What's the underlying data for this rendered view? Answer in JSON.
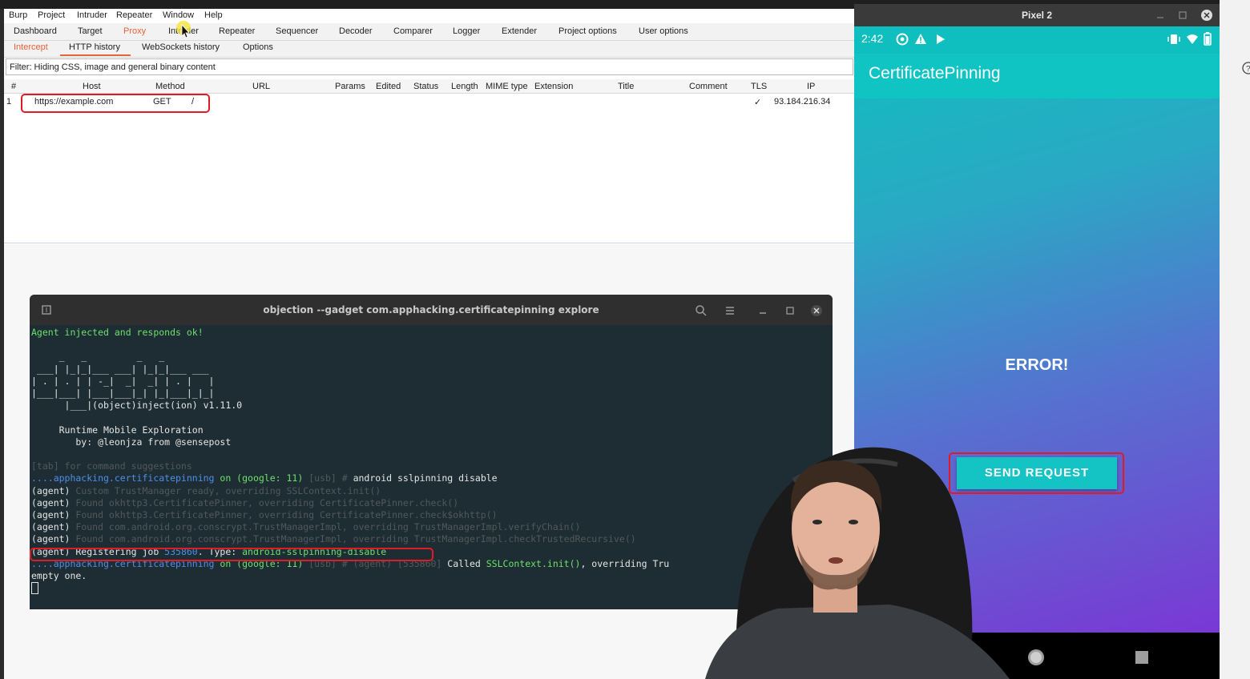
{
  "burp": {
    "menu": [
      "Burp",
      "Project",
      "Intruder",
      "Repeater",
      "Window",
      "Help"
    ],
    "tabs": [
      "Dashboard",
      "Target",
      "Proxy",
      "Intruder",
      "Repeater",
      "Sequencer",
      "Decoder",
      "Comparer",
      "Logger",
      "Extender",
      "Project options",
      "User options"
    ],
    "subtabs": [
      "Intercept",
      "HTTP history",
      "WebSockets history",
      "Options"
    ],
    "filter": "Filter: Hiding CSS, image and general binary content",
    "columns": [
      "#",
      "Host",
      "Method",
      "URL",
      "Params",
      "Edited",
      "Status",
      "Length",
      "MIME type",
      "Extension",
      "Title",
      "Comment",
      "TLS",
      "IP"
    ],
    "row": {
      "num": "1",
      "host": "https://example.com",
      "method": "GET",
      "url": "/",
      "tls": "✓",
      "ip": "93.184.216.34"
    }
  },
  "terminal": {
    "title": "objection --gadget com.apphacking.certificatepinning explore",
    "lines": {
      "injected": "Agent injected and responds ok!",
      "art1": "     _   _         _   _",
      "art2": " ___| |_|_|___ ___| |_|_|___ ___",
      "art3": "| . | . | | -_|  _|  _| | . |   |",
      "art4": "|___|___| |___|___|_| |_|___|_|_|",
      "art5": "      |___|(object)inject(ion) v1.11.0",
      "rt1": "     Runtime Mobile Exploration",
      "rt2": "        by: @leonjza from @sensepost",
      "tab": "[tab] for command suggestions",
      "p1a": "....apphacking.certificatepinning",
      "p1b": " on (google: 11) ",
      "p1c": "[usb] # ",
      "p1d": "android sslpinning disable",
      "ag": "(agent) ",
      "a1": "Custom TrustManager ready, overriding SSLContext.init()",
      "a2": "Found okhttp3.CertificatePinner, overriding CertificatePinner.check()",
      "a3": "Found okhttp3.CertificatePinner, overriding CertificatePinner.check$okhttp()",
      "a4": "Found com.android.org.conscrypt.TrustManagerImpl, overriding TrustManagerImpl.verifyChain()",
      "a5": "Found com.android.org.conscrypt.TrustManagerImpl, overriding TrustManagerImpl.checkTrustedRecursive()",
      "reg1": "(agent) Registering job ",
      "regjob": "535860",
      "reg2": ". Type: ",
      "regtype": "android-sslpinning-disable",
      "p2c": "[usb] # (agent) ",
      "p2job": "[535860] ",
      "p2d": "Called ",
      "p2e": "SSLContext.init()",
      "p2f": ", overriding Tru",
      "empty": "empty one."
    }
  },
  "phone": {
    "window_title": "Pixel 2",
    "time": "2:42",
    "app_title": "CertificatePinning",
    "error": "ERROR!",
    "button": "SEND REQUEST"
  }
}
